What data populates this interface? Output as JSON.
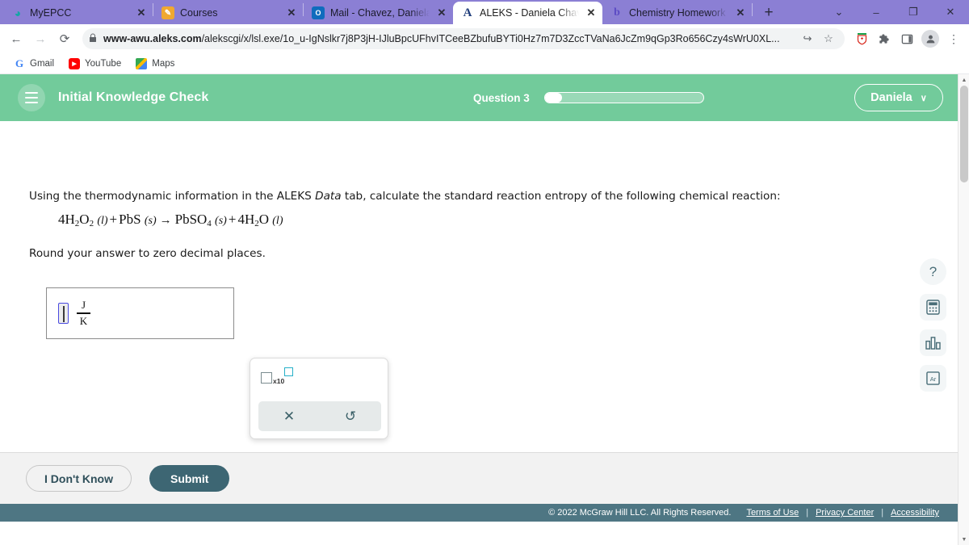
{
  "browser": {
    "tabs": [
      {
        "title": "MyEPCC",
        "favicon": "myepcc-icon",
        "glyph": "◕",
        "active": false,
        "close": "✕"
      },
      {
        "title": "Courses",
        "favicon": "courses-icon",
        "glyph": "✎",
        "active": false,
        "close": "✕"
      },
      {
        "title": "Mail - Chavez, Daniela M.",
        "favicon": "outlook-mail-icon",
        "glyph": "O",
        "active": false,
        "close": "✕"
      },
      {
        "title": "ALEKS - Daniela Chavez -",
        "favicon": "aleks-icon",
        "glyph": "A",
        "active": true,
        "close": "✕"
      },
      {
        "title": "Chemistry Homework Help",
        "favicon": "bing-icon",
        "glyph": "b",
        "active": false,
        "close": "✕"
      }
    ],
    "new_tab_label": "+",
    "window_controls": {
      "collapse": "⌄",
      "minimize": "–",
      "restore": "❐",
      "close": "✕"
    },
    "nav": {
      "back": "←",
      "forward": "→",
      "reload": "⟳"
    },
    "omnibox": {
      "lock": "ὑ2",
      "url_bold": "www-awu.aleks.com",
      "url_rest": "/alekscgi/x/lsl.exe/1o_u-IgNslkr7j8P3jH-IJluBpcUFhvITCeeBZbufuBYTi0Hz7m7D3ZccTVaNa6JcZm9qGp3Ro656Czy4sWrU0XL...",
      "share": "↪",
      "bookmark_star": "☆"
    },
    "extensions": [
      {
        "name": "shield-extension-icon",
        "glyph": "⛉"
      },
      {
        "name": "puzzle-extensions-icon",
        "glyph": "✦"
      },
      {
        "name": "sidepanel-icon",
        "glyph": "□"
      }
    ],
    "profile_icon": "●",
    "menu_icon": "⋮",
    "bookmarks": [
      {
        "label": "Gmail",
        "icon": "gmail-icon",
        "glyph": "G"
      },
      {
        "label": "YouTube",
        "icon": "youtube-icon",
        "glyph": "▶"
      },
      {
        "label": "Maps",
        "icon": "maps-icon",
        "glyph": ""
      }
    ]
  },
  "app": {
    "header": {
      "menu_icon": "hamburger-menu-icon",
      "title": "Initial Knowledge Check",
      "question_label": "Question 3",
      "progress_percent": 11,
      "user_name": "Daniela",
      "user_caret": "∨",
      "accent_color": "#72cb9b"
    },
    "question": {
      "prompt_part1": "Using the thermodynamic information in the ALEKS ",
      "prompt_italic": "Data",
      "prompt_part2": " tab, calculate the standard reaction entropy of the following chemical reaction:",
      "equation_plain": "4H2O2 (l) + PbS (s) → PbSO4 (s) + 4H2O (l)",
      "equation_terms": [
        {
          "coef": "4",
          "formula": "H",
          "sub1": "2",
          "formula2": "O",
          "sub2": "2",
          "state": "(l)"
        },
        {
          "coef": "",
          "formula": "PbS",
          "state": "(s)"
        },
        {
          "coef": "",
          "formula": "PbSO",
          "sub1": "4",
          "state": "(s)"
        },
        {
          "coef": "4",
          "formula": "H",
          "sub1": "2",
          "formula2": "O",
          "state": "(l)"
        }
      ],
      "plus": "+",
      "arrow": "→",
      "rounding_note": "Round your answer to zero decimal places."
    },
    "answer": {
      "value": "",
      "unit_numerator": "J",
      "unit_denominator": "K"
    },
    "mathpad": {
      "sci_notation_label": "x10",
      "clear_icon": "✕",
      "undo_icon": "↺"
    },
    "tools": [
      {
        "name": "help-icon",
        "label": "?"
      },
      {
        "name": "calculator-icon",
        "label": ""
      },
      {
        "name": "bar-chart-icon",
        "label": ""
      },
      {
        "name": "periodic-table-icon",
        "label": "Ar"
      }
    ],
    "actions": {
      "dont_know_label": "I Don't Know",
      "submit_label": "Submit",
      "submit_color": "#3d6673"
    },
    "footer": {
      "copyright": "© 2022 McGraw Hill LLC. All Rights Reserved.",
      "links": [
        "Terms of Use",
        "Privacy Center",
        "Accessibility"
      ],
      "separator": "|",
      "bg_color": "#4e7683"
    }
  }
}
